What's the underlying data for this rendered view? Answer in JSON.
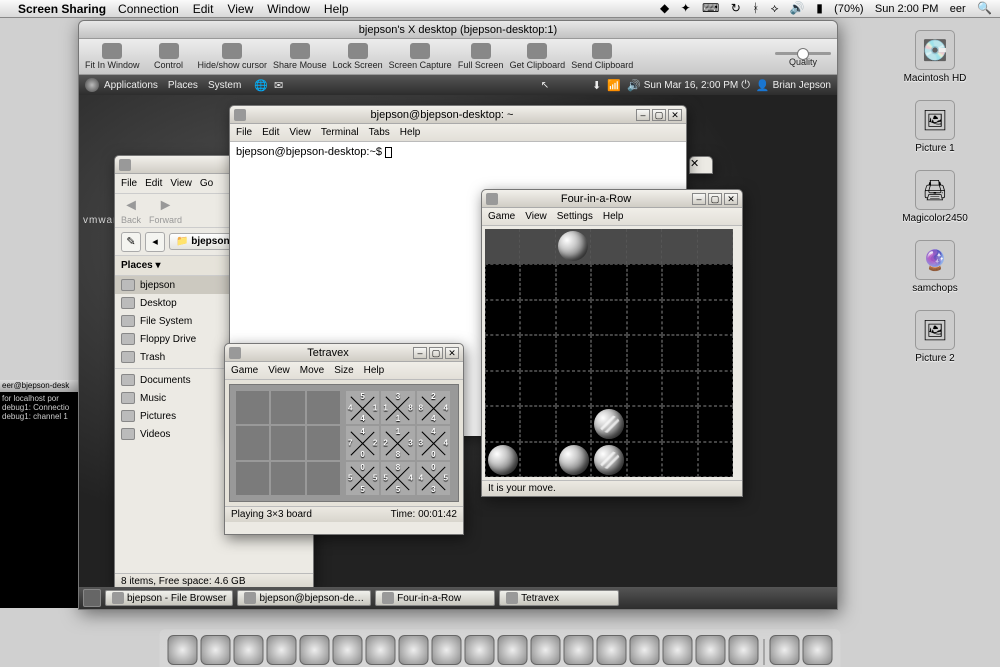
{
  "mac_menubar": {
    "app": "Screen Sharing",
    "items": [
      "Connection",
      "Edit",
      "View",
      "Window",
      "Help"
    ],
    "battery": "(70%)",
    "clock": "Sun 2:00 PM",
    "user": "eer"
  },
  "desktop_icons": [
    {
      "label": "Macintosh HD"
    },
    {
      "label": "Picture 1"
    },
    {
      "label": "Magicolor2450"
    },
    {
      "label": "samchops"
    },
    {
      "label": "Picture 2"
    }
  ],
  "ssw": {
    "title": "bjepson's X desktop (bjepson-desktop:1)",
    "toolbar": [
      "Fit In Window",
      "Control",
      "Hide/show cursor",
      "Share Mouse",
      "Lock Screen",
      "Screen Capture",
      "Full Screen",
      "Get Clipboard",
      "Send Clipboard"
    ],
    "quality": "Quality"
  },
  "gnome_panel": {
    "menus": [
      "Applications",
      "Places",
      "System"
    ],
    "clock": "Sun Mar 16,  2:00 PM",
    "user": "Brian Jepson"
  },
  "vmware": "vmware",
  "terminal": {
    "title": "bjepson@bjepson-desktop: ~",
    "menu": [
      "File",
      "Edit",
      "View",
      "Terminal",
      "Tabs",
      "Help"
    ],
    "prompt": "bjepson@bjepson-desktop:~$ "
  },
  "file_browser": {
    "menu": [
      "File",
      "Edit",
      "View",
      "Go"
    ],
    "nav": {
      "back": "Back",
      "forward": "Forward"
    },
    "location": "bjepson",
    "places_hdr": "Places",
    "places": [
      "bjepson",
      "Desktop",
      "File System",
      "Floppy Drive",
      "Trash",
      "Documents",
      "Music",
      "Pictures",
      "Videos"
    ],
    "status": "8 items, Free space: 4.6 GB"
  },
  "four": {
    "title": "Four-in-a-Row",
    "menu": [
      "Game",
      "View",
      "Settings",
      "Help"
    ],
    "status": "It is your move."
  },
  "tetravex": {
    "title": "Tetravex",
    "menu": [
      "Game",
      "View",
      "Move",
      "Size",
      "Help"
    ],
    "status_left": "Playing 3×3 board",
    "status_right": "Time: 00:01:42",
    "tiles": [
      {
        "t": "5",
        "r": "1",
        "b": "4",
        "l": "4"
      },
      {
        "t": "3",
        "r": "8",
        "b": "1",
        "l": "1"
      },
      {
        "t": "2",
        "r": "4",
        "b": "4",
        "l": "8"
      },
      {
        "t": "4",
        "r": "2",
        "b": "0",
        "l": "7"
      },
      {
        "t": "1",
        "r": "3",
        "b": "8",
        "l": "2"
      },
      {
        "t": "4",
        "r": "4",
        "b": "0",
        "l": "3"
      },
      {
        "t": "0",
        "r": "5",
        "b": "5",
        "l": "5"
      },
      {
        "t": "8",
        "r": "4",
        "b": "5",
        "l": "5"
      },
      {
        "t": "0",
        "r": "5",
        "b": "3",
        "l": "4"
      }
    ]
  },
  "taskbar": [
    "bjepson - File Browser",
    "bjepson@bjepson-de…",
    "Four-in-a-Row",
    "Tetravex"
  ],
  "host_term": {
    "title": "eer@bjepson-desk",
    "lines": [
      "for localhost por",
      "debug1: Connectio",
      "debug1: channel 1"
    ]
  }
}
